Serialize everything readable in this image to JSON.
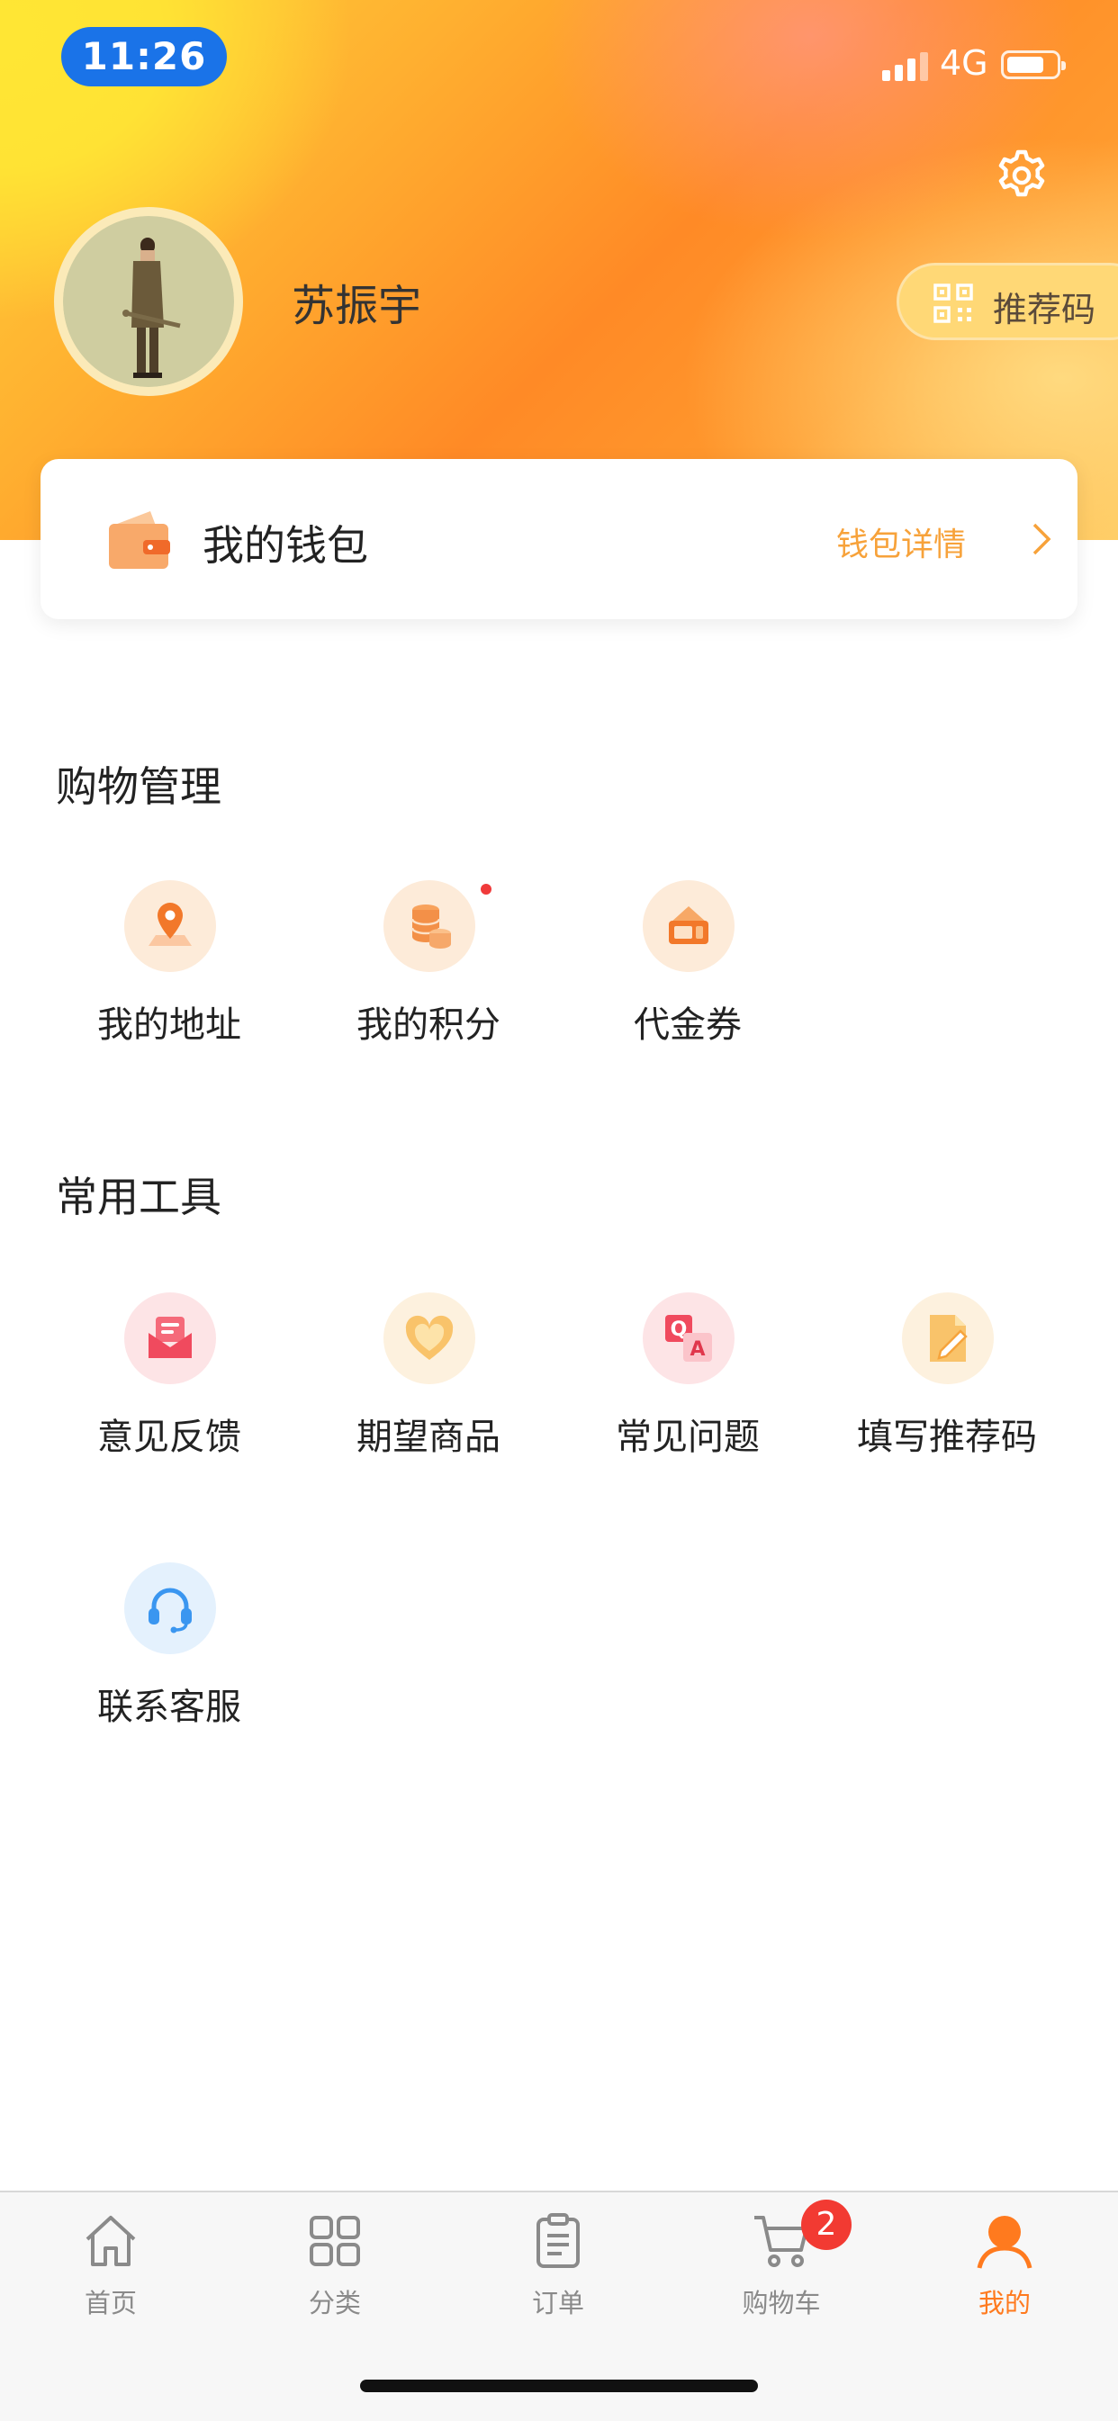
{
  "status_bar": {
    "time": "11:26",
    "network": "4G"
  },
  "profile": {
    "username": "苏振宇",
    "referral_button": "推荐码"
  },
  "wallet": {
    "title": "我的钱包",
    "detail_link": "钱包详情"
  },
  "shopping": {
    "title": "购物管理",
    "items": [
      {
        "label": "我的地址",
        "icon": "location-pin-icon"
      },
      {
        "label": "我的积分",
        "icon": "coins-icon"
      },
      {
        "label": "代金券",
        "icon": "voucher-icon"
      }
    ]
  },
  "tools": {
    "title": "常用工具",
    "items": [
      {
        "label": "意见反馈",
        "icon": "feedback-envelope-icon"
      },
      {
        "label": "期望商品",
        "icon": "heart-box-icon"
      },
      {
        "label": "常见问题",
        "icon": "qa-icon"
      },
      {
        "label": "填写推荐码",
        "icon": "edit-document-icon"
      },
      {
        "label": "联系客服",
        "icon": "headset-icon"
      }
    ]
  },
  "tabbar": {
    "items": [
      {
        "label": "首页",
        "icon": "home-icon"
      },
      {
        "label": "分类",
        "icon": "grid-icon"
      },
      {
        "label": "订单",
        "icon": "clipboard-icon"
      },
      {
        "label": "购物车",
        "icon": "cart-icon",
        "badge": "2"
      },
      {
        "label": "我的",
        "icon": "person-icon",
        "active": true
      }
    ]
  },
  "colors": {
    "accent": "#ff7a1e",
    "link": "#f7a23a",
    "badge": "#f23a32",
    "time_pill": "#1a73e8"
  }
}
